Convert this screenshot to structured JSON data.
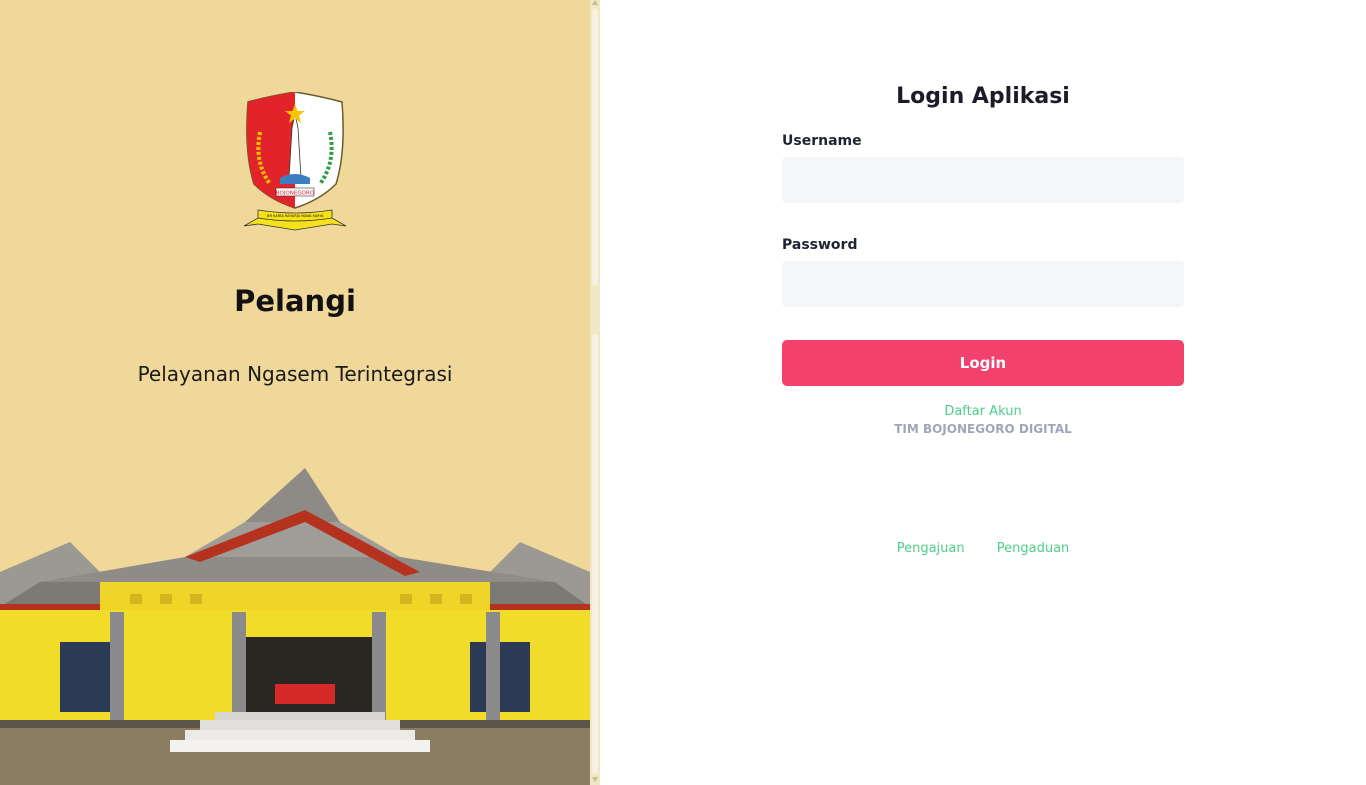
{
  "brand": {
    "app_name": "Pelangi",
    "tagline": "Pelayanan Ngasem Terintegrasi",
    "logo_text": "BOJONEGORO",
    "logo_ribbon_text": "JER KARTA RAHARJA MAWA KARYA"
  },
  "login": {
    "title": "Login Aplikasi",
    "username_label": "Username",
    "username_value": "",
    "password_label": "Password",
    "password_value": "",
    "submit_label": "Login",
    "register_link": "Daftar Akun",
    "team_credit": "TIM BOJONEGORO DIGITAL"
  },
  "footer_links": [
    {
      "label": "Pengajuan"
    },
    {
      "label": "Pengaduan"
    }
  ],
  "colors": {
    "left_background": "#efd899",
    "accent": "#f1416c",
    "link": "#50cd89",
    "muted": "#a1a5b7",
    "input_bg": "#f4f7fa"
  }
}
